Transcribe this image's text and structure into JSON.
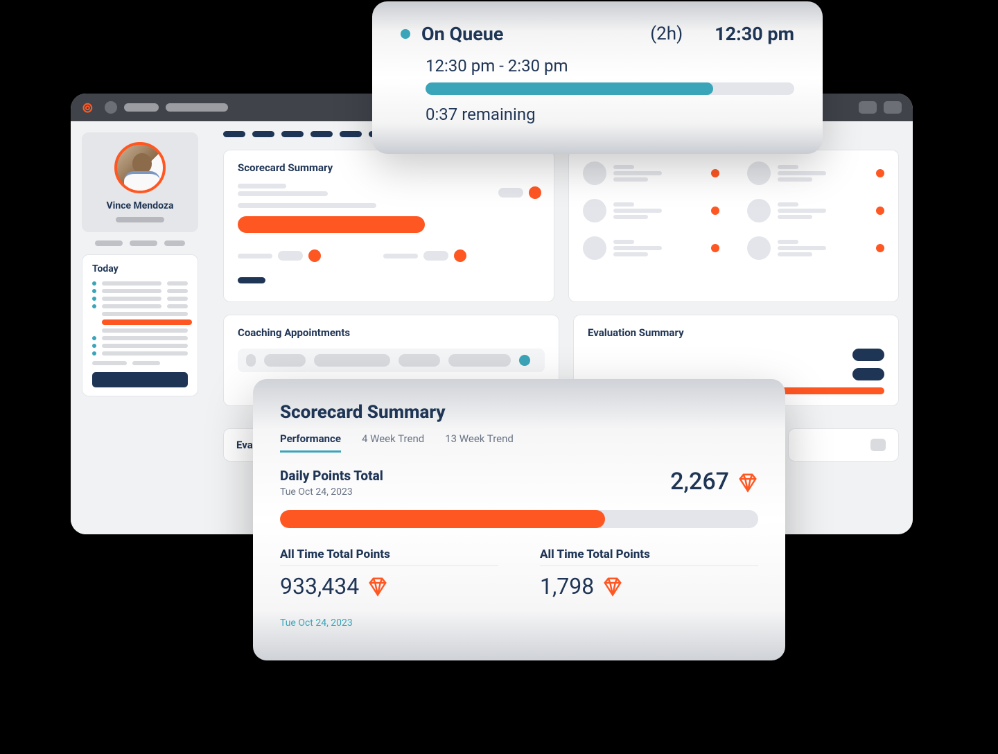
{
  "colors": {
    "accent": "#ff5722",
    "teal": "#3aa5b8",
    "navy": "#1f3555"
  },
  "sidebar": {
    "user_name": "Vince Mendoza",
    "today_heading": "Today"
  },
  "dashboard": {
    "scorecard_panel_title": "Scorecard Summary",
    "coaching_panel_title": "Coaching Appointments",
    "evaluation_panel_title": "Evaluation Summary",
    "eval_small_title": "Eval"
  },
  "queue": {
    "status_label": "On Queue",
    "duration_label": "(2h)",
    "current_time": "12:30 pm",
    "time_range": "12:30 pm - 2:30 pm",
    "remaining_text": "0:37 remaining",
    "progress_pct": 78
  },
  "scorecard": {
    "title": "Scorecard Summary",
    "tabs": {
      "performance": "Performance",
      "trend4": "4 Week Trend",
      "trend13": "13 Week Trend"
    },
    "daily": {
      "heading": "Daily Points Total",
      "date": "Tue Oct 24, 2023",
      "points": "2,267",
      "progress_pct": 68
    },
    "totals": {
      "col1_heading": "All Time Total Points",
      "col1_value": "933,434",
      "col2_heading": "All Time Total Points",
      "col2_value": "1,798"
    },
    "footer_date": "Tue Oct 24, 2023"
  }
}
